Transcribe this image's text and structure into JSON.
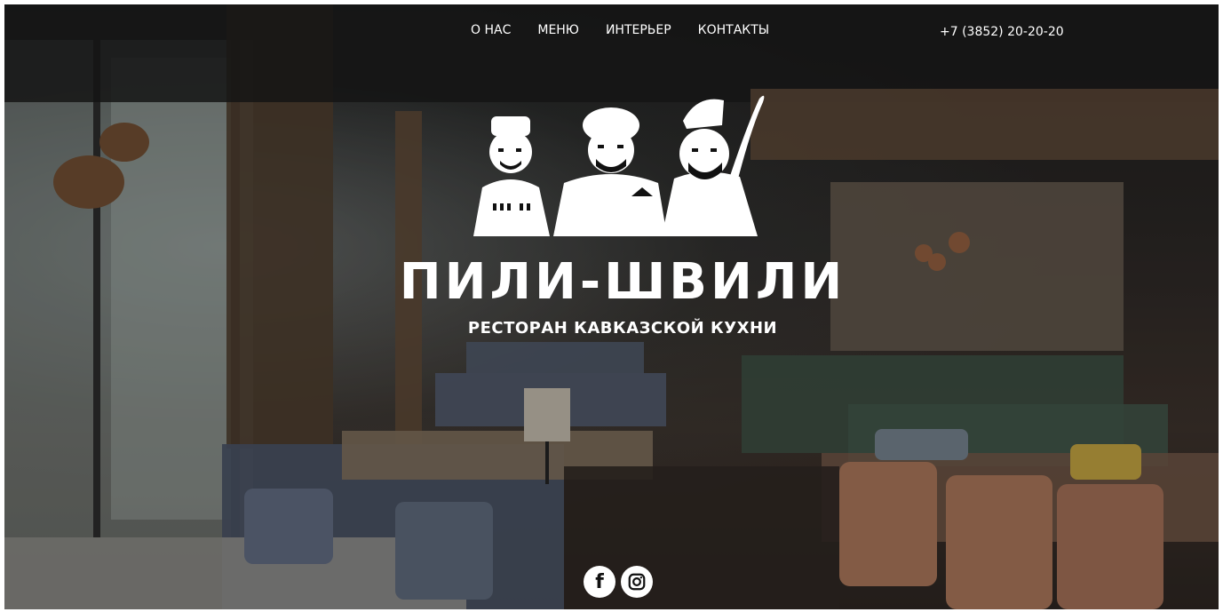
{
  "nav": {
    "items": [
      {
        "label": "О НАС"
      },
      {
        "label": "МЕНЮ"
      },
      {
        "label": "ИНТЕРЬЕР"
      },
      {
        "label": "КОНТАКТЫ"
      }
    ],
    "phone": "+7 (3852) 20-20-20"
  },
  "hero": {
    "brand_name": "ПИЛИ-ШВИЛИ",
    "subtitle": "РЕСТОРАН КАВКАЗСКОЙ КУХНИ",
    "background_description_colors": {
      "dark": "#1c1c1c",
      "warm": "#3a302a"
    }
  },
  "social": {
    "facebook_glyph": "f",
    "icons": [
      "facebook-icon",
      "instagram-icon"
    ]
  }
}
